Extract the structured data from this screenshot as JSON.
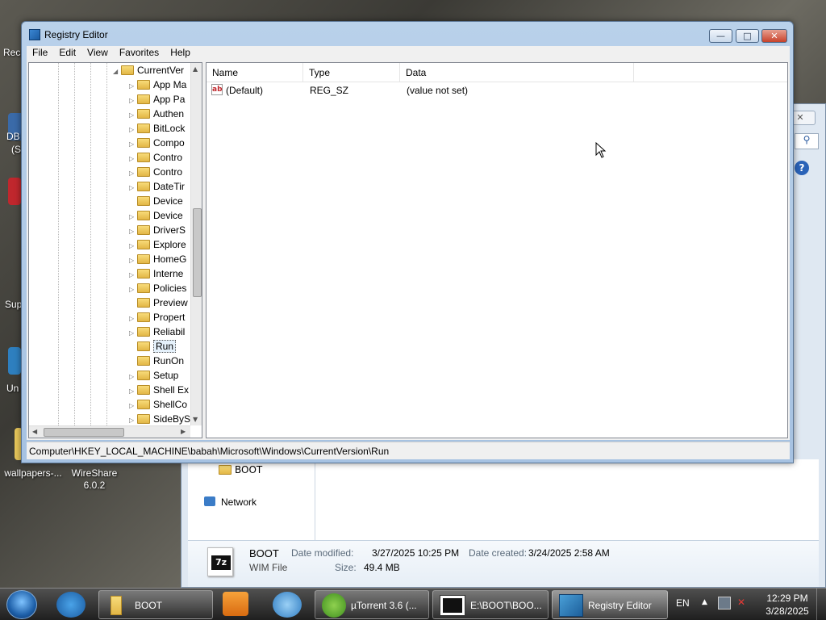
{
  "desktop": {
    "icons": [
      {
        "label": "wallpapers-..."
      },
      {
        "label": "WireShare\n6.0.2"
      }
    ],
    "partial_labels": [
      "Rec",
      "DB",
      "(S",
      "Sup",
      "Un"
    ]
  },
  "explorer": {
    "nav_folder": "BOOT",
    "nav_network": "Network",
    "details": {
      "name": "BOOT",
      "type": "WIM File",
      "date_modified_label": "Date modified:",
      "date_modified": "3/27/2025 10:25 PM",
      "date_created_label": "Date created:",
      "date_created": "3/24/2025 2:58 AM",
      "size_label": "Size:",
      "size": "49.4 MB",
      "file_icon_text": "7z"
    }
  },
  "regedit": {
    "title": "Registry Editor",
    "window_buttons": {
      "minimize": "—",
      "maximize": "□",
      "close": "✕"
    },
    "menu": [
      "File",
      "Edit",
      "View",
      "Favorites",
      "Help"
    ],
    "tree": {
      "parent": "CurrentVer",
      "items": [
        {
          "label": "App Ma",
          "expandable": true
        },
        {
          "label": "App Pa",
          "expandable": true
        },
        {
          "label": "Authen",
          "expandable": true
        },
        {
          "label": "BitLock",
          "expandable": true
        },
        {
          "label": "Compo",
          "expandable": true
        },
        {
          "label": "Contro",
          "expandable": true
        },
        {
          "label": "Contro",
          "expandable": true
        },
        {
          "label": "DateTir",
          "expandable": true
        },
        {
          "label": "Device",
          "expandable": false
        },
        {
          "label": "Device",
          "expandable": true
        },
        {
          "label": "DriverS",
          "expandable": true
        },
        {
          "label": "Explore",
          "expandable": true
        },
        {
          "label": "HomeG",
          "expandable": true
        },
        {
          "label": "Interne",
          "expandable": true
        },
        {
          "label": "Policies",
          "expandable": true
        },
        {
          "label": "Preview",
          "expandable": false
        },
        {
          "label": "Propert",
          "expandable": true
        },
        {
          "label": "Reliabil",
          "expandable": true
        },
        {
          "label": "Run",
          "expandable": false,
          "selected": true
        },
        {
          "label": "RunOn",
          "expandable": false
        },
        {
          "label": "Setup",
          "expandable": true
        },
        {
          "label": "Shell Ex",
          "expandable": true
        },
        {
          "label": "ShellCo",
          "expandable": true
        },
        {
          "label": "SideByS",
          "expandable": true
        }
      ]
    },
    "columns": [
      "Name",
      "Type",
      "Data"
    ],
    "values": [
      {
        "name": "(Default)",
        "type": "REG_SZ",
        "data": "(value not set)",
        "icon_text": "ab"
      }
    ],
    "status_path": "Computer\\HKEY_LOCAL_MACHINE\\babah\\Microsoft\\Windows\\CurrentVersion\\Run"
  },
  "taskbar": {
    "items": [
      {
        "label": "BOOT"
      },
      {
        "label": "µTorrent 3.6  (..."
      },
      {
        "label": "E:\\BOOT\\BOO..."
      },
      {
        "label": "Registry Editor",
        "active": true
      }
    ],
    "tray": {
      "language": "EN",
      "time": "12:29 PM",
      "date": "3/28/2025"
    }
  }
}
